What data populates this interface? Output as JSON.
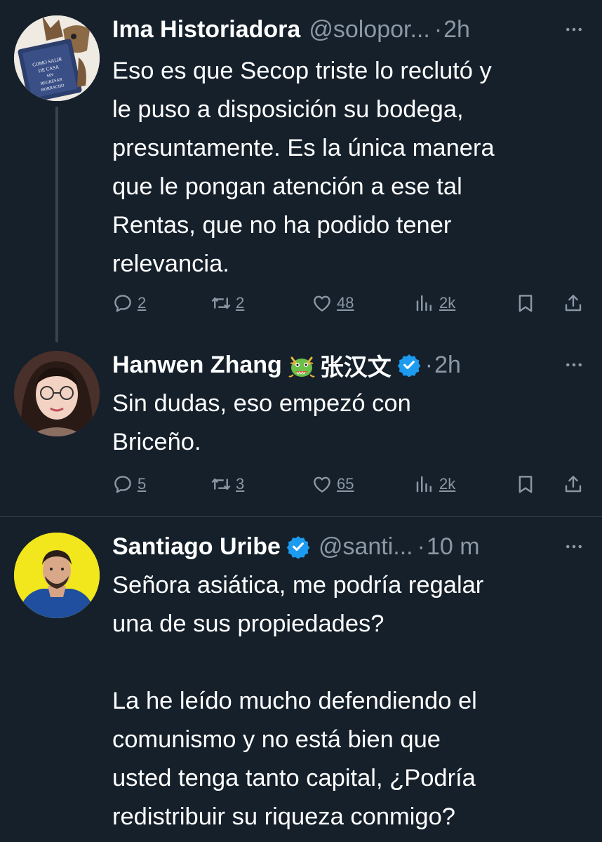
{
  "colors": {
    "background": "#15202b",
    "text_primary": "#ffffff",
    "text_secondary": "#8b98a5",
    "verified_blue": "#1d9bf0",
    "divider": "#38444d"
  },
  "tweets": [
    {
      "name": "Ima Historiadora",
      "handle": "@solopor...",
      "separator": "·",
      "time": "2h",
      "avatar_book_text": "COMO SALIR DE CASA SIN REGRESAR BORRACHO",
      "text": "Eso es que Secop triste lo reclutó y\nle puso a disposición su bodega,\npresuntamente. Es la única manera\nque le pongan atención a ese tal\nRentas, que no ha podido tener\nrelevancia.",
      "replies": "2",
      "retweets": "2",
      "likes": "48",
      "views": "2k"
    },
    {
      "name": "Hanwen Zhang",
      "name_suffix": "张汉文",
      "emoji": "dragon-face",
      "separator": "·",
      "time": "2h",
      "text": "Sin dudas, eso empezó con\nBriceño.",
      "replies": "5",
      "retweets": "3",
      "likes": "65",
      "views": "2k"
    },
    {
      "name": "Santiago Uribe",
      "handle": "@santi...",
      "separator": "·",
      "time": "10 m",
      "text": "Señora asiática, me podría regalar\nuna de sus propiedades?\n\nLa he leído mucho defendiendo el\ncomunismo y no está bien que\nusted tenga tanto capital, ¿Podría\nredistribuir su riqueza conmigo?"
    }
  ],
  "icons": {
    "reply": "reply-icon",
    "retweet": "retweet-icon",
    "like": "heart-icon",
    "views": "views-icon",
    "bookmark": "bookmark-icon",
    "share": "share-icon",
    "more": "more-icon",
    "verified": "verified-badge-icon"
  }
}
